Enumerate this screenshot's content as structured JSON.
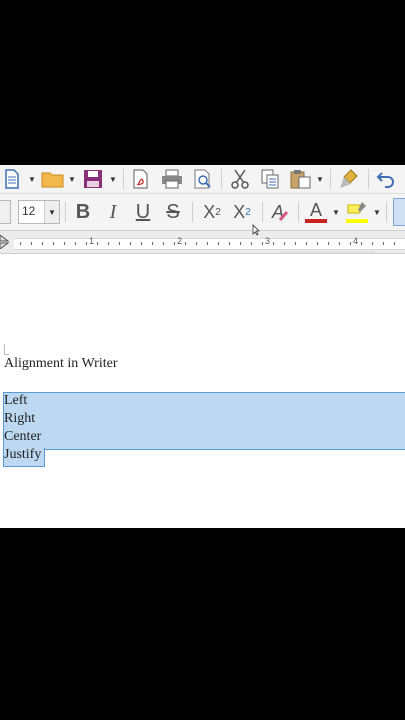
{
  "toolbar_standard": {
    "items": [
      {
        "name": "new-document-icon",
        "glyph": "🗎"
      },
      {
        "name": "open-folder-icon",
        "glyph": "📂"
      },
      {
        "name": "save-icon",
        "glyph": "💾"
      },
      {
        "name": "export-pdf-icon",
        "glyph": "🗎"
      },
      {
        "name": "print-icon",
        "glyph": "🖶"
      },
      {
        "name": "print-preview-icon",
        "glyph": "🔍"
      },
      {
        "name": "cut-icon",
        "glyph": "✂"
      },
      {
        "name": "copy-icon",
        "glyph": "⧉"
      },
      {
        "name": "paste-icon",
        "glyph": "📋"
      },
      {
        "name": "clone-formatting-icon",
        "glyph": "🖌"
      },
      {
        "name": "undo-icon",
        "glyph": "↶"
      }
    ]
  },
  "toolbar_format": {
    "font_size": "12",
    "bold": "B",
    "italic": "I",
    "underline": "U",
    "strikethrough": "S",
    "superscript": "X",
    "superscript_mark": "2",
    "subscript": "X",
    "subscript_mark": "2",
    "clear_direct_formatting": "A",
    "font_color": "A",
    "font_color_hex": "#c9211e",
    "highlight_hex": "#ffff00"
  },
  "ruler": {
    "labels": [
      "1",
      "2",
      "3",
      "4"
    ]
  },
  "document": {
    "heading": "Alignment in Writer",
    "lines": [
      "Left",
      "Right",
      "Center",
      "Justify"
    ]
  },
  "colors": {
    "selection_fill": "#bcd9f1",
    "selection_border": "#5a9ad6",
    "icon_blue": "#3d6fb4"
  }
}
